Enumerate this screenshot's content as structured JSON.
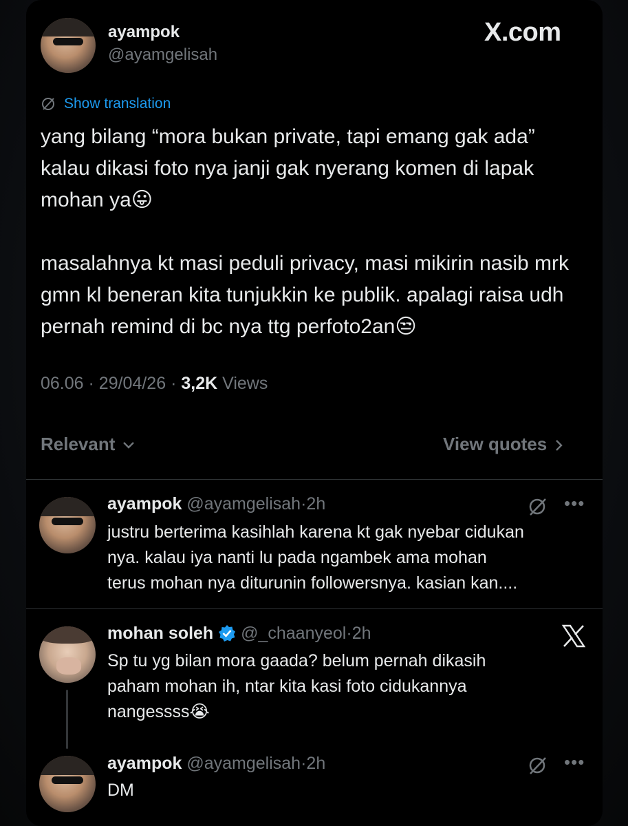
{
  "main_post": {
    "display_name": "ayampok",
    "handle": "@ayamgelisah",
    "watermark": "X.com",
    "translate_label": "Show translation",
    "text": "yang bilang “mora bukan private, tapi emang gak ada” kalau dikasi foto nya janji gak nyerang komen di lapak mohan ya😛\n\nmasalahnya kt masi peduli privacy, masi mikirin nasib mrk gmn kl beneran kita tunjukkin ke publik. apalagi raisa udh pernah remind di bc nya ttg perfoto2an😒",
    "time": "06.06",
    "date": "29/04/26",
    "views_count": "3,2K",
    "views_label": "Views"
  },
  "controls": {
    "sort_label": "Relevant",
    "view_quotes_label": "View quotes"
  },
  "replies": [
    {
      "display_name": "ayampok",
      "handle": "@ayamgelisah",
      "age": "2h",
      "text": "justru berterima kasihlah karena kt gak nyebar cidukan\nnya. kalau iya nanti lu pada ngambek ama mohan\nterus mohan nya diturunin followersnya. kasian kan...."
    },
    {
      "display_name": "mohan soleh",
      "handle": "@_chaanyeol",
      "age": "2h",
      "verified": true,
      "text": "Sp tu yg bilan mora gaada? belum pernah dikasih\npaham mohan ih, ntar kita kasi foto cidukannya\nnangessss😭"
    },
    {
      "display_name": "ayampok",
      "handle": "@ayamgelisah",
      "age": "2h",
      "text": "DM"
    }
  ],
  "separator": "·",
  "colors": {
    "background": "#000000",
    "text": "#e7e9ea",
    "muted": "#71767b",
    "link": "#1d9bf0",
    "verified": "#1d9bf0"
  }
}
